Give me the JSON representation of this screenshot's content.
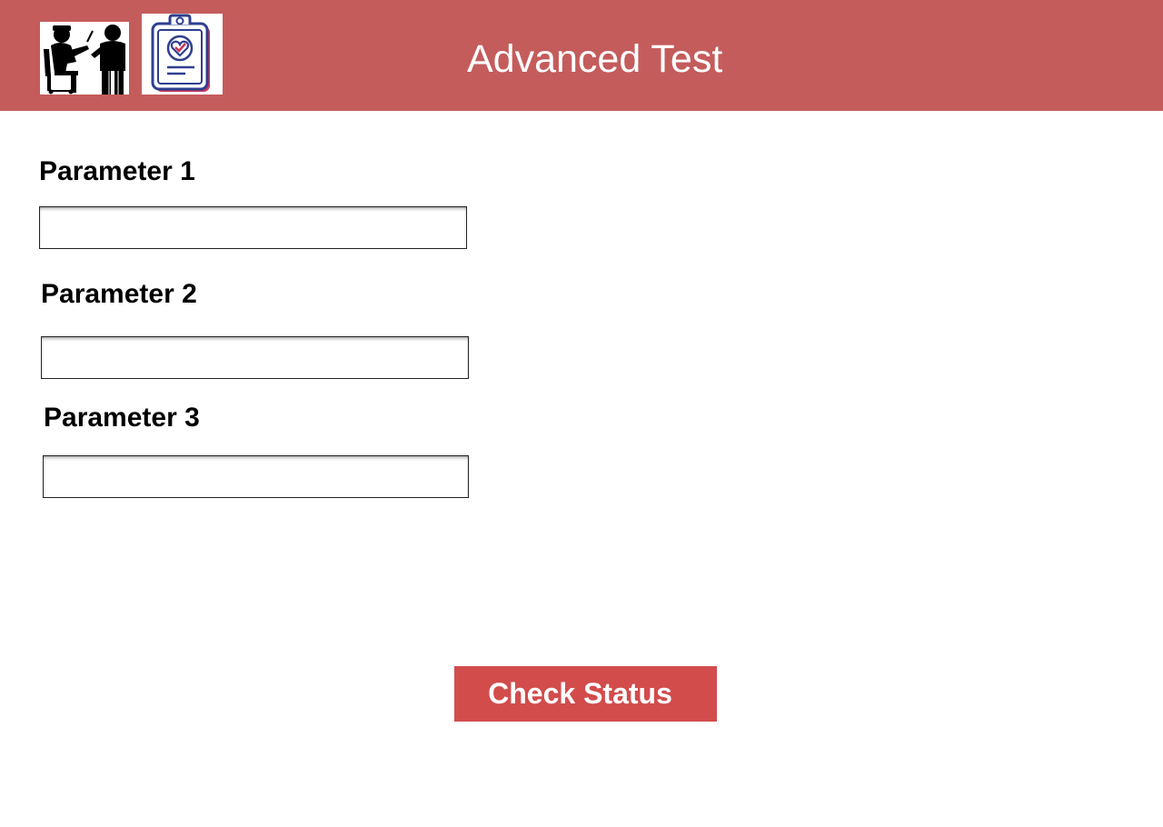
{
  "header": {
    "title": "Advanced Test",
    "background_color": "#c45c5c",
    "icons": [
      "doctor-patient-icon",
      "clipboard-check-icon"
    ]
  },
  "form": {
    "parameters": [
      {
        "label": "Parameter 1",
        "value": "",
        "placeholder": ""
      },
      {
        "label": "Parameter 2",
        "value": "",
        "placeholder": ""
      },
      {
        "label": "Parameter 3",
        "value": "",
        "placeholder": ""
      }
    ],
    "submit_label": "Check Status",
    "submit_color": "#d24c4c"
  }
}
